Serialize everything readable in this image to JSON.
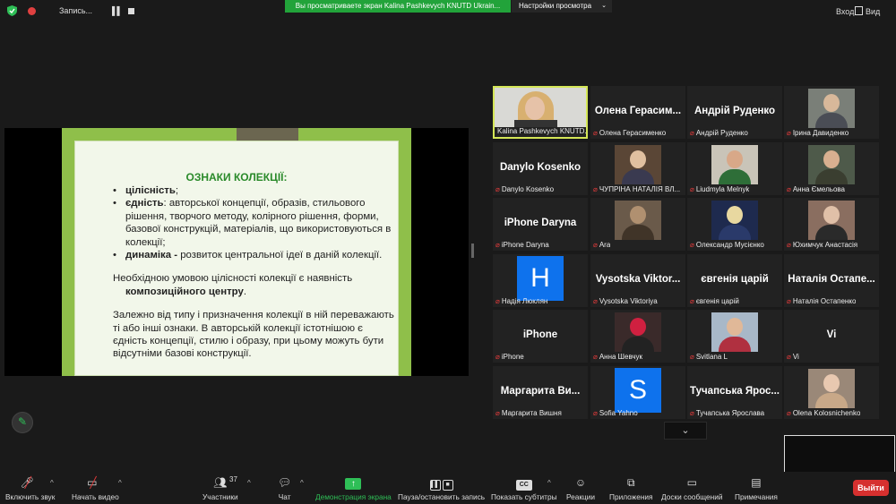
{
  "topbar": {
    "rec_label": "Запись...",
    "pause_icon": "pause-icon",
    "share_banner": "Вы просматриваете экран Kalina Pashkevych KNUTD Ukrain...",
    "view_settings": "Настройки просмотра",
    "login": "Вход",
    "view": "Вид"
  },
  "slide": {
    "title": "ОЗНАКИ КОЛЕКЦІЇ:",
    "b1_bold": "цілісність",
    "b1_rest": ";",
    "b2_bold": "єдність",
    "b2_rest": ": авторської концепції, образів, стильового рішення, творчого методу, колірного рішення, форми, базової конструкцій, матеріалів, що використовуються в колекції;",
    "b3_bold": "динаміка -",
    "b3_rest": " розвиток центральної ідеї в даній колекції.",
    "p1_start": "Необхідною умовою цілісності колекції є наявність",
    "p1_bold": "композиційного центру",
    "p1_end": ".",
    "p2": "Залежно від типу і призначення колекції в ній переважають ті або інші ознаки. В авторській колекції істотнішою є єдність концепції, стилю і образу, при цьому можуть бути відсутніми базові конструкції."
  },
  "participants": [
    {
      "type": "cam",
      "caption": "Kalina Pashkevych KNUTD...",
      "muted": false
    },
    {
      "type": "name",
      "name": "Олена  Герасим...",
      "caption": "Олена Герасименко"
    },
    {
      "type": "name",
      "name": "Андрій Руденко",
      "caption": "Андрій Руденко"
    },
    {
      "type": "photo",
      "caption": "Ірина Давиденко",
      "bg": "#7a7f78",
      "head": "#d8b89a",
      "body": "#4a4d55"
    },
    {
      "type": "name",
      "name": "Danylo Kosenko",
      "caption": "Danylo Kosenko"
    },
    {
      "type": "photo",
      "caption": "ЧУПРІНА НАТАЛІЯ ВЛ...",
      "bg": "#5a4636",
      "head": "#e0c0a0",
      "body": "#3a3a50"
    },
    {
      "type": "photo",
      "caption": "Liudmyla Melnyk",
      "bg": "#c9c4b8",
      "head": "#d8a888",
      "body": "#2e6e38"
    },
    {
      "type": "photo",
      "caption": "Анна Ємельова",
      "bg": "#4e5a4a",
      "head": "#d8b090",
      "body": "#3a3e30"
    },
    {
      "type": "name",
      "name": "iPhone Daryna",
      "caption": "iPhone Daryna"
    },
    {
      "type": "photo",
      "caption": "Ara",
      "bg": "#6a5a4a",
      "head": "#b09070",
      "body": "#403428"
    },
    {
      "type": "photo",
      "caption": "Олександр Мусієнко",
      "bg": "#1e2a4e",
      "head": "#e8d8a0",
      "body": "#2a3a6a"
    },
    {
      "type": "photo",
      "caption": "Юхимчук Анастасія",
      "bg": "#8a6e60",
      "head": "#e0c0a8",
      "body": "#2a2a2a"
    },
    {
      "type": "letter",
      "letter": "H",
      "caption": "Надія Люклян"
    },
    {
      "type": "name",
      "name": "Vysotska  Viktor...",
      "caption": "Vysotska Viktoriya"
    },
    {
      "type": "name",
      "name": "євгенія царій",
      "caption": "євгенія царій"
    },
    {
      "type": "name",
      "name": "Наталія  Остапе...",
      "caption": "Наталія Остапенко"
    },
    {
      "type": "name",
      "name": "iPhone",
      "caption": "iPhone"
    },
    {
      "type": "photo",
      "caption": "Анна Шевчук",
      "bg": "#3a2a2a",
      "head": "#d02040",
      "body": "#222222"
    },
    {
      "type": "photo",
      "caption": "Svitlana L",
      "bg": "#a8b8c8",
      "head": "#e0b898",
      "body": "#b03040"
    },
    {
      "type": "name",
      "name": "Vi",
      "caption": "Vi"
    },
    {
      "type": "name",
      "name": "Маргарита  Ви...",
      "caption": "Маргарита Вишня"
    },
    {
      "type": "letter",
      "letter": "S",
      "caption": "Sofia Yahno"
    },
    {
      "type": "name",
      "name": "Тучапська  Ярос...",
      "caption": "Тучапська Ярослава"
    },
    {
      "type": "photo",
      "caption": "Olena Kolosnichenko",
      "bg": "#9a8878",
      "head": "#e8c8b0",
      "body": "#c8a888"
    }
  ],
  "toolbar": {
    "mute": "Включить звук",
    "video": "Начать видео",
    "participants": "Участники",
    "participants_count": "37",
    "chat": "Чат",
    "share": "Демонстрация экрана",
    "pause_rec": "Пауза/остановить запись",
    "subtitles": "Показать субтитры",
    "cc": "CC",
    "reactions": "Реакции",
    "apps": "Приложения",
    "whiteboards": "Доски сообщений",
    "notes": "Примечания",
    "exit": "Выйти"
  },
  "colors": {
    "accent_green": "#2fbf57",
    "active_border": "#d4e657",
    "exit_red": "#d6302f",
    "muted_red": "#e23b3b"
  }
}
